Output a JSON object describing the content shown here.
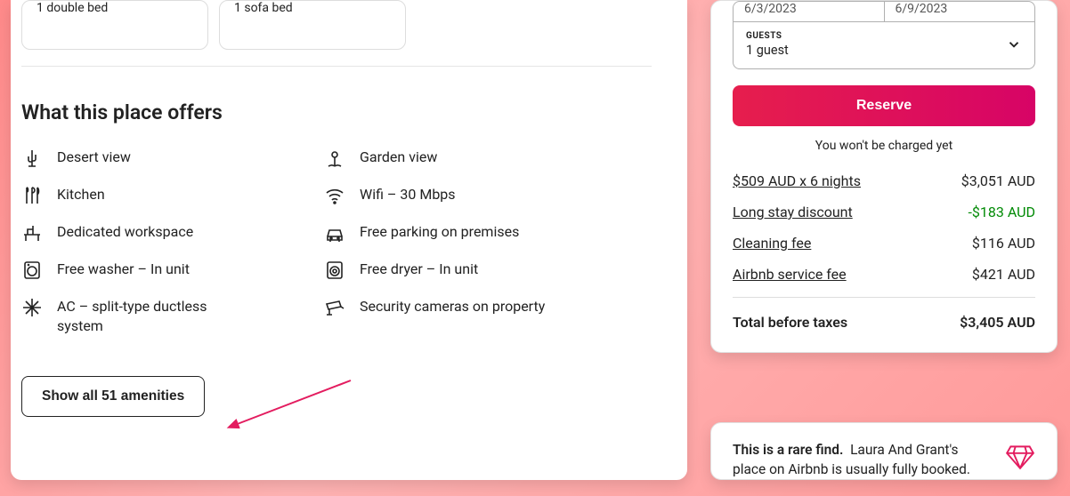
{
  "beds": [
    {
      "label": "1 double bed"
    },
    {
      "label": "1 sofa bed"
    }
  ],
  "amenities_section": {
    "title": "What this place offers",
    "items": [
      {
        "icon": "cactus",
        "label": "Desert view"
      },
      {
        "icon": "flower",
        "label": "Garden view"
      },
      {
        "icon": "utensils",
        "label": "Kitchen"
      },
      {
        "icon": "wifi",
        "label": "Wifi – 30 Mbps"
      },
      {
        "icon": "desk",
        "label": "Dedicated workspace"
      },
      {
        "icon": "car",
        "label": "Free parking on premises"
      },
      {
        "icon": "washer",
        "label": "Free washer – In unit"
      },
      {
        "icon": "dryer",
        "label": "Free dryer – In unit"
      },
      {
        "icon": "snowflake",
        "label": "AC – split-type ductless system"
      },
      {
        "icon": "camera",
        "label": "Security cameras on property"
      }
    ],
    "show_all_label": "Show all 51 amenities"
  },
  "booking": {
    "checkin": "6/3/2023",
    "checkout": "6/9/2023",
    "guests_heading": "GUESTS",
    "guests_value": "1 guest",
    "reserve_label": "Reserve",
    "note": "You won't be charged yet",
    "lines": [
      {
        "label": "$509 AUD x 6 nights",
        "value": "$3,051 AUD",
        "discount": false
      },
      {
        "label": "Long stay discount",
        "value": "-$183 AUD",
        "discount": true
      },
      {
        "label": "Cleaning fee",
        "value": "$116 AUD",
        "discount": false
      },
      {
        "label": "Airbnb service fee",
        "value": "$421 AUD",
        "discount": false
      }
    ],
    "total_label": "Total before taxes",
    "total_value": "$3,405 AUD"
  },
  "rare_find": {
    "bold": "This is a rare find.",
    "rest": "Laura And Grant's place on Airbnb is usually fully booked."
  }
}
